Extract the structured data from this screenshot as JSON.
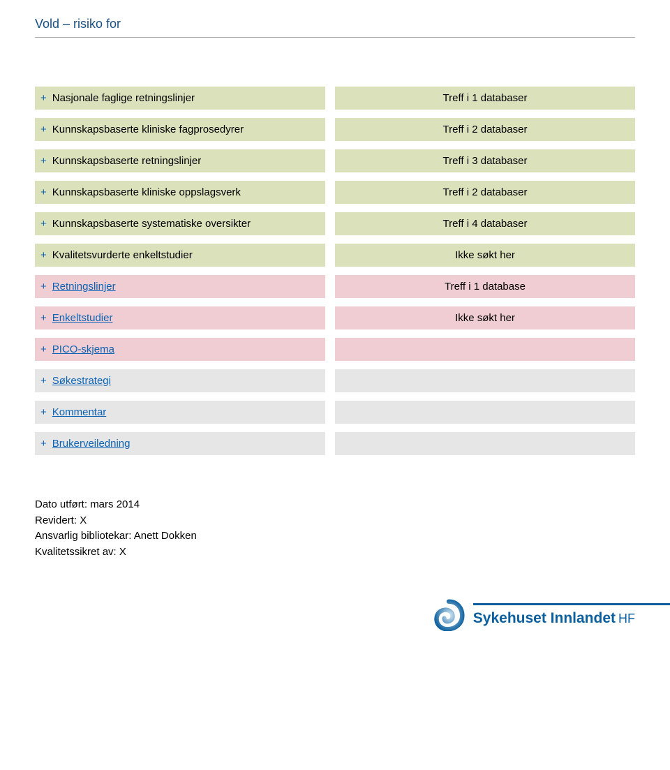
{
  "page_title": "Vold – risiko for",
  "rows": [
    {
      "group": "green",
      "link": false,
      "label": "Nasjonale faglige retningslinjer",
      "value": "Treff i  1 databaser"
    },
    {
      "group": "green",
      "link": false,
      "label": "Kunnskapsbaserte kliniske fagprosedyrer",
      "value": "Treff i  2 databaser"
    },
    {
      "group": "green",
      "link": false,
      "label": "Kunnskapsbaserte retningslinjer",
      "value": "Treff i  3 databaser"
    },
    {
      "group": "green",
      "link": false,
      "label": "Kunnskapsbaserte kliniske oppslagsverk",
      "value": "Treff i  2 databaser"
    },
    {
      "group": "green",
      "link": false,
      "label": "Kunnskapsbaserte systematiske oversikter",
      "value": "Treff i  4 databaser"
    },
    {
      "group": "green",
      "link": false,
      "label": "Kvalitetsvurderte enkeltstudier",
      "value": "Ikke søkt her"
    },
    {
      "group": "red",
      "link": true,
      "label": "Retningslinjer",
      "value": "Treff i  1 database"
    },
    {
      "group": "red",
      "link": true,
      "label": "Enkeltstudier",
      "value": "Ikke søkt her"
    },
    {
      "group": "red",
      "link": true,
      "label": "PICO-skjema",
      "value": ""
    },
    {
      "group": "gray",
      "link": true,
      "label": "Søkestrategi",
      "value": ""
    },
    {
      "group": "gray",
      "link": true,
      "label": "Kommentar",
      "value": ""
    },
    {
      "group": "gray",
      "link": true,
      "label": "Brukerveiledning",
      "value": ""
    }
  ],
  "footer": {
    "line1": "Dato utført: mars 2014",
    "line2": "Revidert: X",
    "line3": "Ansvarlig bibliotekar: Anett Dokken",
    "line4": "Kvalitetssikret av: X"
  },
  "logo": {
    "name": "Sykehuset Innlandet",
    "suffix": "HF"
  }
}
